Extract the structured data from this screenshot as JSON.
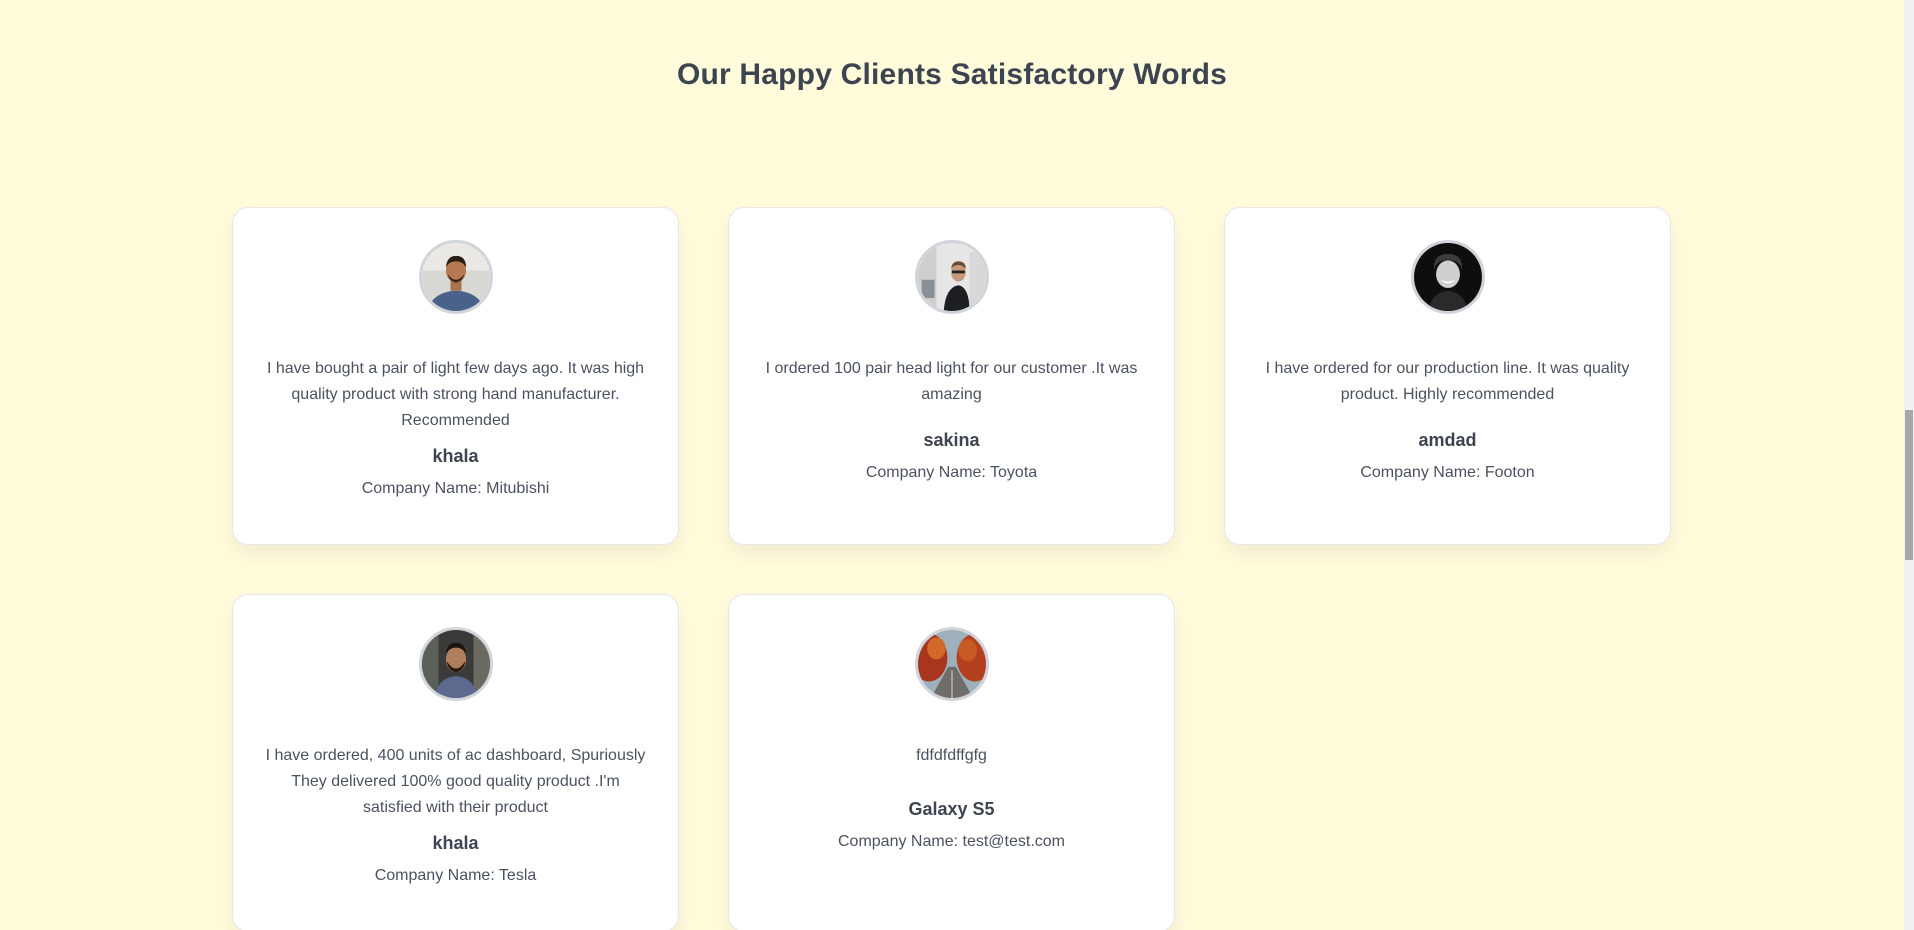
{
  "section": {
    "title": "Our Happy Clients Satisfactory Words"
  },
  "testimonials": [
    {
      "quote": "I have bought a pair of light few days ago. It was high quality product with strong hand manufacturer. Recommended",
      "name": "khala",
      "company": "Company Name: Mitubishi",
      "avatar_icon": "man-blue-shirt-photo"
    },
    {
      "quote": "I ordered 100 pair head light for our customer .It was amazing",
      "name": "sakina",
      "company": "Company Name: Toyota",
      "avatar_icon": "man-street-photo"
    },
    {
      "quote": "I have ordered for our production line. It was quality product. Highly recommended",
      "name": "amdad",
      "company": "Company Name: Footon",
      "avatar_icon": "man-smiling-bw-photo"
    },
    {
      "quote": "I have ordered, 400 units of ac dashboard, Spuriously They delivered 100% good quality product .I'm satisfied with their product",
      "name": "khala",
      "company": "Company Name: Tesla",
      "avatar_icon": "man-beard-photo"
    },
    {
      "quote": "fdfdfdffgfg",
      "name": "Galaxy S5",
      "company": "Company Name: test@test.com",
      "avatar_icon": "autumn-road-photo"
    }
  ],
  "colors": {
    "background": "#fffbdb",
    "card": "#ffffff",
    "text": "#3d4451"
  }
}
